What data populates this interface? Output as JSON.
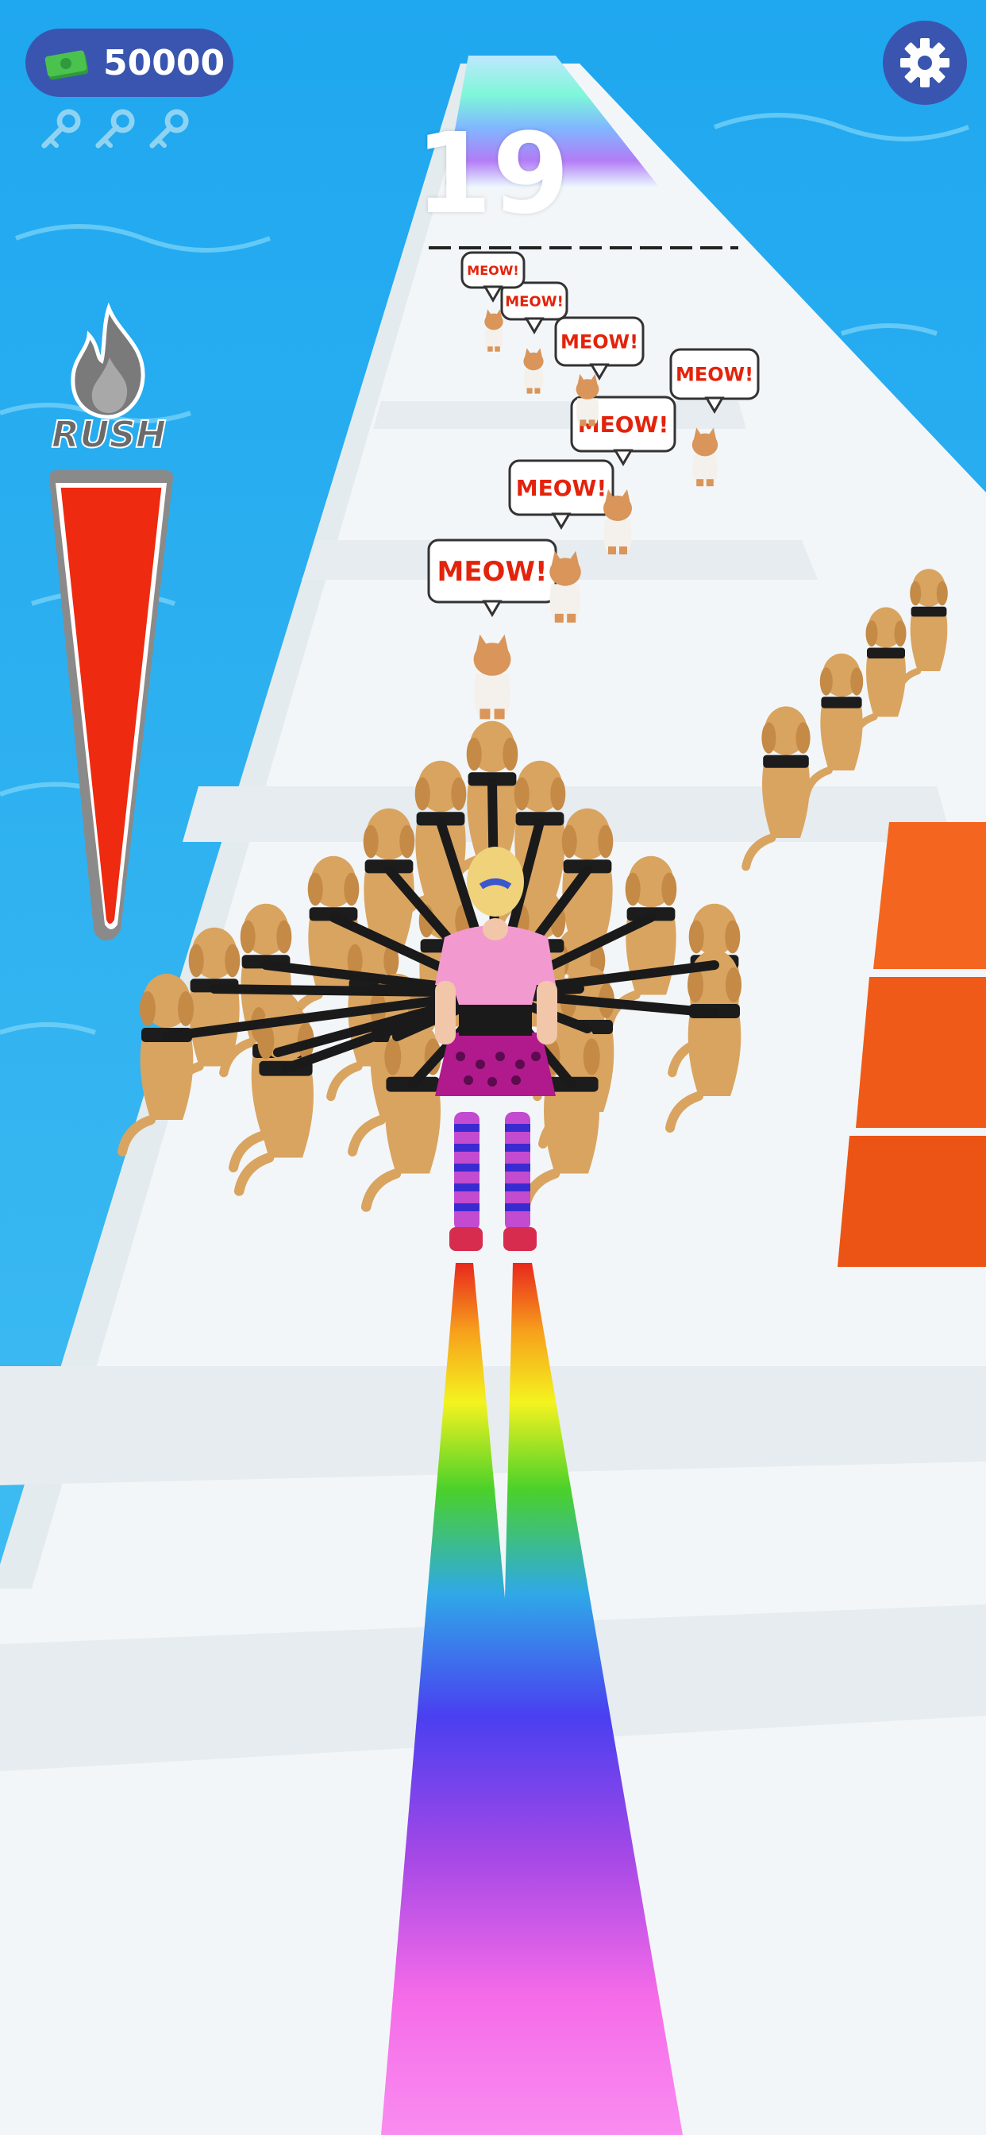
{
  "hud": {
    "cash": "50000",
    "level": "19",
    "rush_label": "RUSH",
    "rush_level": 1.0,
    "keys_collected": 0,
    "keys_total": 3
  },
  "track": {
    "speech_bubbles": [
      "MEOW!",
      "MEOW!",
      "MEOW!",
      "MEOW!",
      "MEOW!",
      "MEOW!",
      "MEOW!"
    ]
  },
  "colors": {
    "water": "#2fb4ee",
    "track": "#f3f6f8",
    "hud_blue": "#3a55b0",
    "rush_fill": "#ee2a10",
    "wall": "#f35a1e"
  }
}
